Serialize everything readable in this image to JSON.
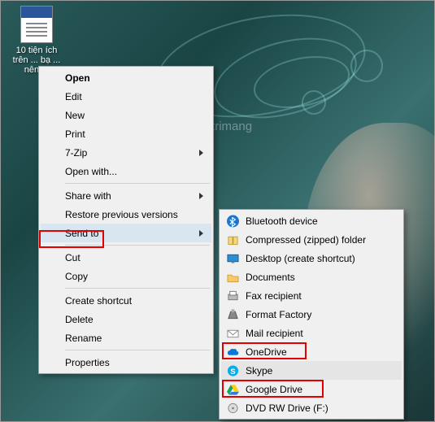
{
  "desktop_file": {
    "label": "10 tiện ích trên ... bạ ... nên ..."
  },
  "watermark": "uantrimang",
  "menu1": {
    "open": "Open",
    "edit": "Edit",
    "new": "New",
    "print": "Print",
    "sevenzip": "7-Zip",
    "openwith": "Open with...",
    "sharewith": "Share with",
    "restore": "Restore previous versions",
    "sendto": "Send to",
    "cut": "Cut",
    "copy": "Copy",
    "shortcut": "Create shortcut",
    "delete": "Delete",
    "rename": "Rename",
    "properties": "Properties"
  },
  "menu2": {
    "bluetooth": "Bluetooth device",
    "compressed": "Compressed (zipped) folder",
    "desktop": "Desktop (create shortcut)",
    "documents": "Documents",
    "fax": "Fax recipient",
    "format": "Format Factory",
    "mail": "Mail recipient",
    "onedrive": "OneDrive",
    "skype": "Skype",
    "gdrive": "Google Drive",
    "dvd": "DVD RW Drive (F:)"
  },
  "icons": {
    "bluetooth": "bluetooth-icon",
    "compressed": "zip-icon",
    "desktop": "desktop-icon",
    "documents": "documents-folder-icon",
    "fax": "fax-icon",
    "format": "format-factory-icon",
    "mail": "mail-icon",
    "onedrive": "onedrive-cloud-icon",
    "skype": "skype-icon",
    "gdrive": "google-drive-icon",
    "dvd": "dvd-drive-icon"
  },
  "colors": {
    "highlight_red": "#e40000",
    "menu_bg": "#f0f0f0",
    "hover_blue": "#d8e6f2"
  }
}
